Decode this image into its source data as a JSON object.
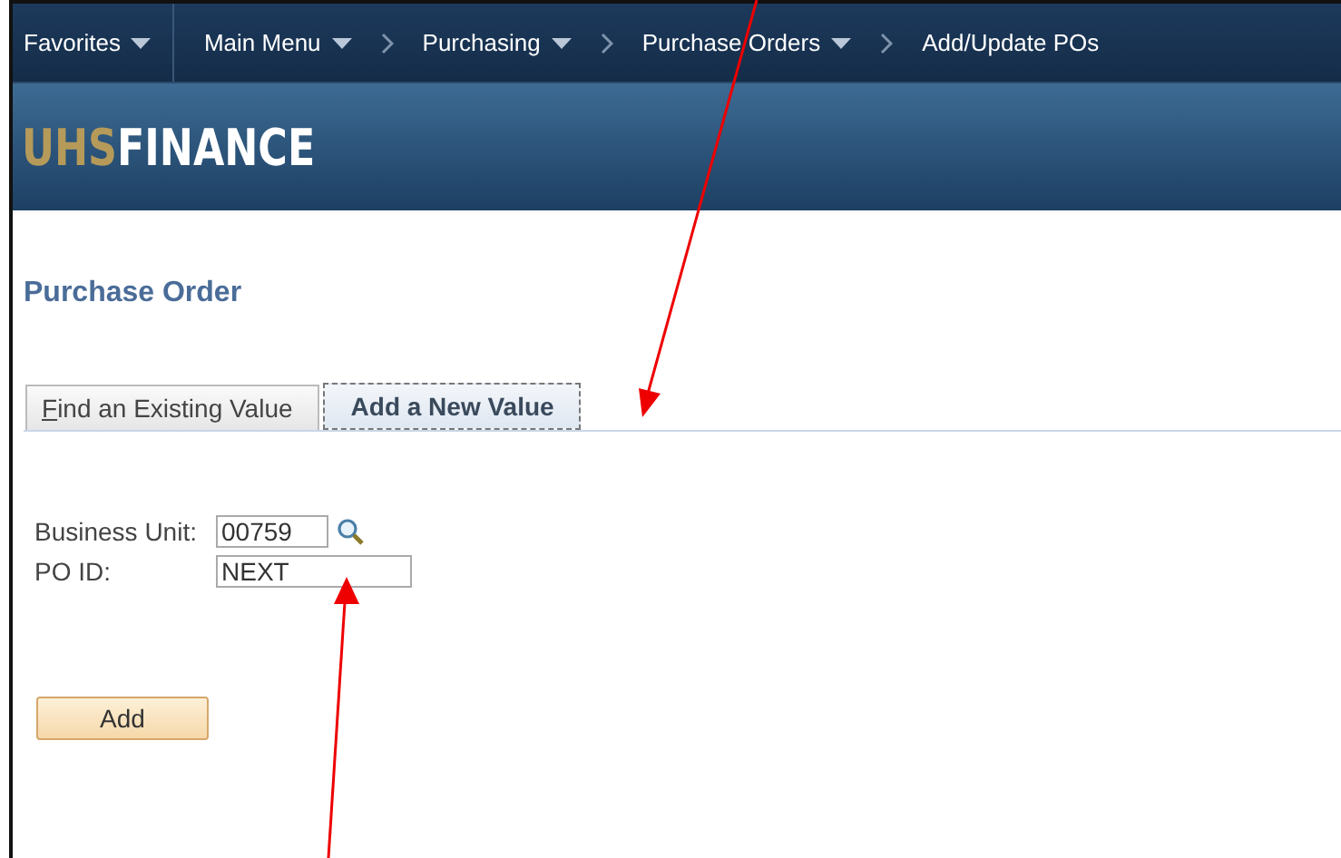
{
  "nav": {
    "items": [
      {
        "label": "Favorites",
        "kind": "menu"
      },
      {
        "label": "Main Menu",
        "kind": "menu"
      },
      {
        "label": "Purchasing",
        "kind": "crumb-menu"
      },
      {
        "label": "Purchase Orders",
        "kind": "crumb-menu"
      },
      {
        "label": "Add/Update POs",
        "kind": "crumb"
      }
    ]
  },
  "banner": {
    "logo_prefix": "UHS",
    "logo_name": "FINANCE"
  },
  "page_title": "Purchase Order",
  "tabs": [
    {
      "label": "Find an Existing Value",
      "selected": false
    },
    {
      "label": "Add a New Value",
      "selected": true
    }
  ],
  "fields": [
    {
      "label": "Business Unit:",
      "value": "00759",
      "lookup": true
    },
    {
      "label": "PO ID:",
      "value": "NEXT",
      "lookup": false
    }
  ],
  "buttons": [
    "Add"
  ]
}
